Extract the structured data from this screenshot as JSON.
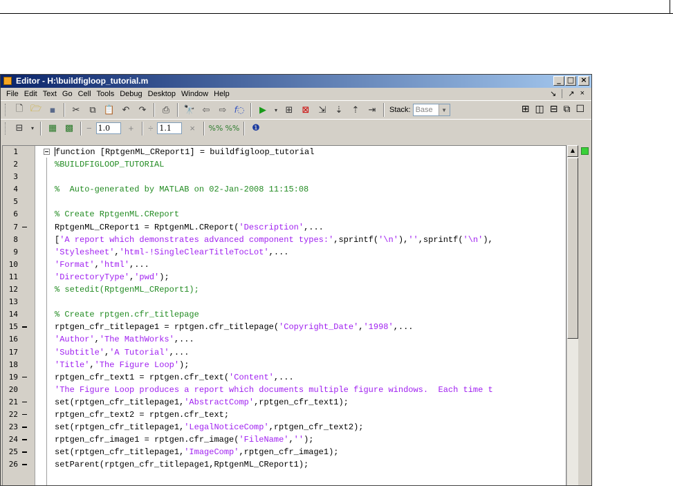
{
  "window": {
    "title": "Editor - H:\\buildfigloop_tutorial.m"
  },
  "menu": [
    "File",
    "Edit",
    "Text",
    "Go",
    "Cell",
    "Tools",
    "Debug",
    "Desktop",
    "Window",
    "Help"
  ],
  "toolbar": {
    "stack_label": "Stack:",
    "stack_value": "Base",
    "cell_minus": "−",
    "cell_plus": "+",
    "cell_value_1": "1.0",
    "divide_symbol": "÷",
    "cell_value_2": "1.1",
    "times_symbol": "×"
  },
  "code": [
    {
      "ln": "1",
      "mark": false,
      "parts": [
        {
          "t": "function [RptgenML_CReport1] = buildfigloop_tutorial",
          "c": "plain"
        }
      ]
    },
    {
      "ln": "2",
      "mark": false,
      "parts": [
        {
          "t": "%BUILDFIGLOOP_TUTORIAL",
          "c": "comment"
        }
      ]
    },
    {
      "ln": "3",
      "mark": false,
      "parts": []
    },
    {
      "ln": "4",
      "mark": false,
      "parts": [
        {
          "t": "%  Auto-generated by MATLAB on 02-Jan-2008 11:15:08",
          "c": "comment"
        }
      ]
    },
    {
      "ln": "5",
      "mark": false,
      "parts": []
    },
    {
      "ln": "6",
      "mark": false,
      "parts": [
        {
          "t": "% Create RptgenML.CReport",
          "c": "comment"
        }
      ]
    },
    {
      "ln": "7",
      "mark": true,
      "parts": [
        {
          "t": "RptgenML_CReport1 = RptgenML.CReport(",
          "c": "plain"
        },
        {
          "t": "'Description'",
          "c": "str"
        },
        {
          "t": ",...",
          "c": "plain"
        }
      ]
    },
    {
      "ln": "8",
      "mark": false,
      "parts": [
        {
          "t": "[",
          "c": "plain"
        },
        {
          "t": "'A report which demonstrates advanced component types:'",
          "c": "str"
        },
        {
          "t": ",sprintf(",
          "c": "plain"
        },
        {
          "t": "'\\n'",
          "c": "str"
        },
        {
          "t": "),",
          "c": "plain"
        },
        {
          "t": "''",
          "c": "str"
        },
        {
          "t": ",sprintf(",
          "c": "plain"
        },
        {
          "t": "'\\n'",
          "c": "str"
        },
        {
          "t": "),",
          "c": "plain"
        }
      ]
    },
    {
      "ln": "9",
      "mark": false,
      "parts": [
        {
          "t": "'Stylesheet'",
          "c": "str"
        },
        {
          "t": ",",
          "c": "plain"
        },
        {
          "t": "'html-!SingleClearTitleTocLot'",
          "c": "str"
        },
        {
          "t": ",...",
          "c": "plain"
        }
      ]
    },
    {
      "ln": "10",
      "mark": false,
      "parts": [
        {
          "t": "'Format'",
          "c": "str"
        },
        {
          "t": ",",
          "c": "plain"
        },
        {
          "t": "'html'",
          "c": "str"
        },
        {
          "t": ",...",
          "c": "plain"
        }
      ]
    },
    {
      "ln": "11",
      "mark": false,
      "parts": [
        {
          "t": "'DirectoryType'",
          "c": "str"
        },
        {
          "t": ",",
          "c": "plain"
        },
        {
          "t": "'pwd'",
          "c": "str"
        },
        {
          "t": ");",
          "c": "plain"
        }
      ]
    },
    {
      "ln": "12",
      "mark": false,
      "parts": [
        {
          "t": "% setedit(RptgenML_CReport1);",
          "c": "comment"
        }
      ]
    },
    {
      "ln": "13",
      "mark": false,
      "parts": []
    },
    {
      "ln": "14",
      "mark": false,
      "parts": [
        {
          "t": "% Create rptgen.cfr_titlepage",
          "c": "comment"
        }
      ]
    },
    {
      "ln": "15",
      "mark": true,
      "parts": [
        {
          "t": "rptgen_cfr_titlepage1 = rptgen.cfr_titlepage(",
          "c": "plain"
        },
        {
          "t": "'Copyright_Date'",
          "c": "str"
        },
        {
          "t": ",",
          "c": "plain"
        },
        {
          "t": "'1998'",
          "c": "str"
        },
        {
          "t": ",...",
          "c": "plain"
        }
      ]
    },
    {
      "ln": "16",
      "mark": false,
      "parts": [
        {
          "t": "'Author'",
          "c": "str"
        },
        {
          "t": ",",
          "c": "plain"
        },
        {
          "t": "'The MathWorks'",
          "c": "str"
        },
        {
          "t": ",...",
          "c": "plain"
        }
      ]
    },
    {
      "ln": "17",
      "mark": false,
      "parts": [
        {
          "t": "'Subtitle'",
          "c": "str"
        },
        {
          "t": ",",
          "c": "plain"
        },
        {
          "t": "'A Tutorial'",
          "c": "str"
        },
        {
          "t": ",...",
          "c": "plain"
        }
      ]
    },
    {
      "ln": "18",
      "mark": false,
      "parts": [
        {
          "t": "'Title'",
          "c": "str"
        },
        {
          "t": ",",
          "c": "plain"
        },
        {
          "t": "'The Figure Loop'",
          "c": "str"
        },
        {
          "t": ");",
          "c": "plain"
        }
      ]
    },
    {
      "ln": "19",
      "mark": true,
      "parts": [
        {
          "t": "rptgen_cfr_text1 = rptgen.cfr_text(",
          "c": "plain"
        },
        {
          "t": "'Content'",
          "c": "str"
        },
        {
          "t": ",...",
          "c": "plain"
        }
      ]
    },
    {
      "ln": "20",
      "mark": false,
      "parts": [
        {
          "t": "'The Figure Loop produces a report which documents multiple figure windows.  Each time t",
          "c": "str"
        }
      ]
    },
    {
      "ln": "21",
      "mark": true,
      "parts": [
        {
          "t": "set(rptgen_cfr_titlepage1,",
          "c": "plain"
        },
        {
          "t": "'AbstractComp'",
          "c": "str"
        },
        {
          "t": ",rptgen_cfr_text1);",
          "c": "plain"
        }
      ]
    },
    {
      "ln": "22",
      "mark": true,
      "parts": [
        {
          "t": "rptgen_cfr_text2 = rptgen.cfr_text;",
          "c": "plain"
        }
      ]
    },
    {
      "ln": "23",
      "mark": true,
      "parts": [
        {
          "t": "set(rptgen_cfr_titlepage1,",
          "c": "plain"
        },
        {
          "t": "'LegalNoticeComp'",
          "c": "str"
        },
        {
          "t": ",rptgen_cfr_text2);",
          "c": "plain"
        }
      ]
    },
    {
      "ln": "24",
      "mark": true,
      "parts": [
        {
          "t": "rptgen_cfr_image1 = rptgen.cfr_image(",
          "c": "plain"
        },
        {
          "t": "'FileName'",
          "c": "str"
        },
        {
          "t": ",",
          "c": "plain"
        },
        {
          "t": "''",
          "c": "str"
        },
        {
          "t": ");",
          "c": "plain"
        }
      ]
    },
    {
      "ln": "25",
      "mark": true,
      "parts": [
        {
          "t": "set(rptgen_cfr_titlepage1,",
          "c": "plain"
        },
        {
          "t": "'ImageComp'",
          "c": "str"
        },
        {
          "t": ",rptgen_cfr_image1);",
          "c": "plain"
        }
      ]
    },
    {
      "ln": "26",
      "mark": true,
      "parts": [
        {
          "t": "setParent(rptgen_cfr_titlepage1,RptgenML_CReport1);",
          "c": "plain"
        }
      ]
    }
  ]
}
